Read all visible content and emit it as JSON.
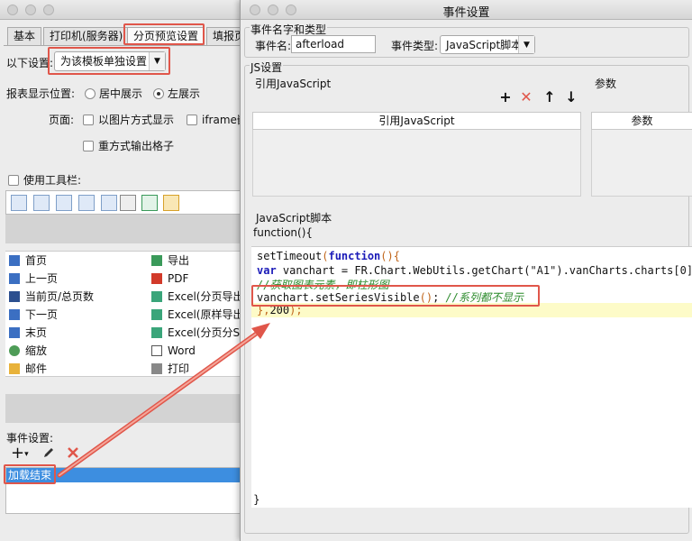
{
  "colors": {
    "accent_red": "#e0564a",
    "selection_blue": "#3d8ee0",
    "keyword_blue": "#1a1ab8",
    "comment_green": "#2a8a2a"
  },
  "back": {
    "tabs": [
      "基本",
      "打印机(服务器)",
      "分页预览设置",
      "填报页"
    ],
    "settings_label": "以下设置:",
    "settings_value": "为该模板单独设置",
    "position_label": "报表显示位置:",
    "position_center": "居中展示",
    "position_left": "左展示",
    "page_label": "页面:",
    "as_image": "以图片方式显示",
    "iframe": "iframe嵌",
    "reprint": "重方式输出格子",
    "use_toolbar": "使用工具栏:",
    "tools_left": [
      "首页",
      "上一页",
      "当前页/总页数",
      "下一页",
      "末页",
      "缩放",
      "邮件"
    ],
    "tools_right": [
      "导出",
      "PDF",
      "Excel(分页导出",
      "Excel(原样导出",
      "Excel(分页分S",
      "Word",
      "打印"
    ],
    "event_label": "事件设置:",
    "event_item": "加载结束"
  },
  "dialog": {
    "title": "事件设置",
    "name_type_group": "事件名字和类型",
    "event_name_label": "事件名:",
    "event_name_value": "afterload",
    "event_type_label": "事件类型:",
    "event_type_value": "JavaScript脚本",
    "js_group": "JS设置",
    "ref_js_title": "引用JavaScript",
    "params_title": "参数",
    "ref_js_col": "引用JavaScript",
    "params_col": "参数",
    "script_group": "JavaScript脚本",
    "func_open": "function(){",
    "func_close": "}",
    "code": {
      "l1_a": "setTimeout",
      "l1_b": "(",
      "l1_c": "function",
      "l1_d": "(){",
      "l2_a": "var",
      "l2_b": " vanchart = FR.Chart.WebUtils.getChart(",
      "l2_c": "\"A1\"",
      "l2_d": ").vanCharts.charts[",
      "l2_e": "0",
      "l2_f": "];",
      "l3": "//获取图表元素，即柱形图",
      "l4_a": "vanchart.setSeriesVisible",
      "l4_b": "()",
      "l4_c": "; ",
      "l4_d": "//系列都不显示",
      "l5_a": "},",
      "l5_b": "200",
      "l5_c": ");"
    }
  }
}
